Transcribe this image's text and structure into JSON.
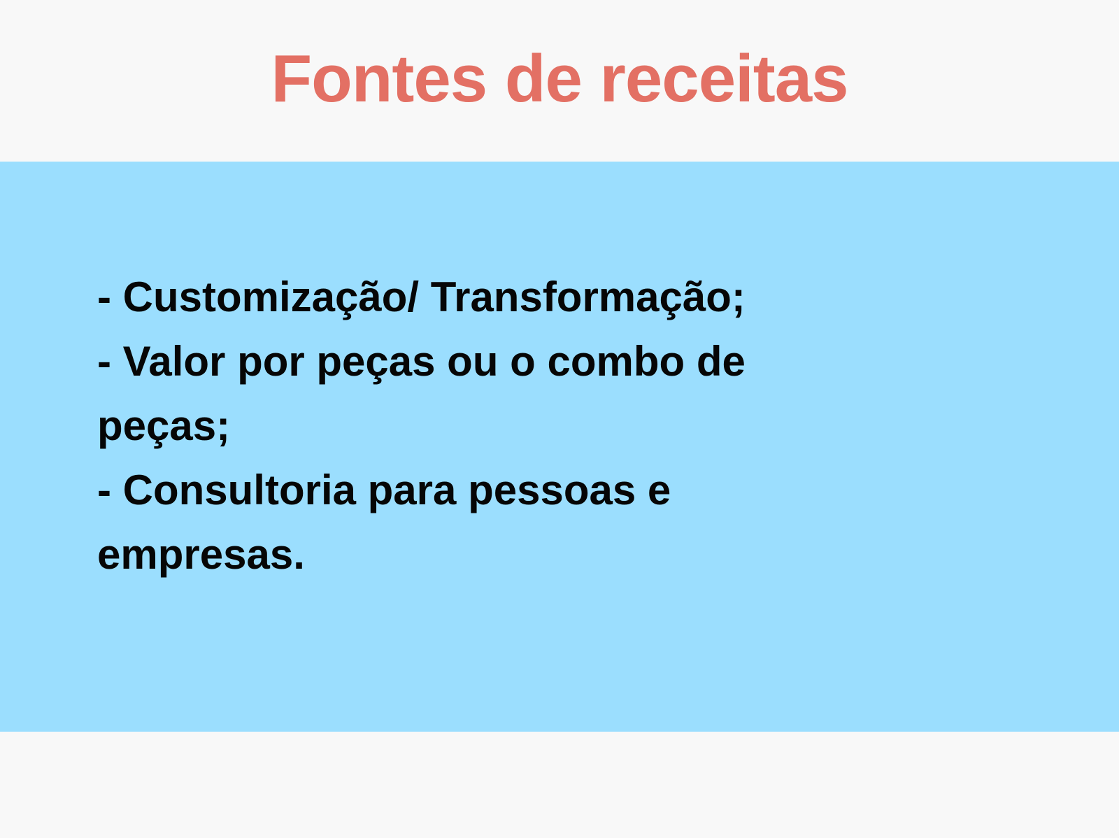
{
  "slide": {
    "title": "Fontes de receitas",
    "items": [
      "- Customização/ Transformação;",
      "- Valor por peças ou o combo de peças;",
      "- Consultoria para pessoas e empresas."
    ]
  },
  "colors": {
    "title": "#e37064",
    "band": "#9bdefe",
    "background": "#f8f8f8",
    "text": "#060606"
  }
}
